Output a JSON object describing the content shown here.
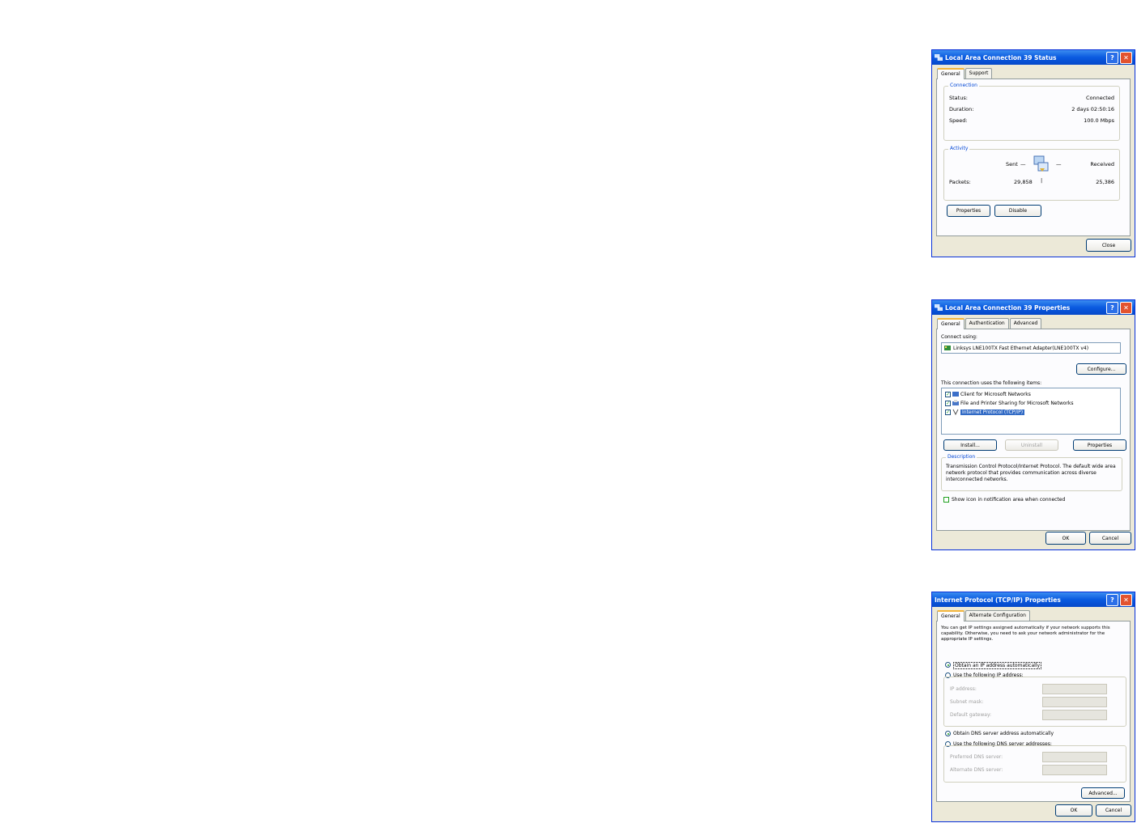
{
  "status_window": {
    "title": "Local Area Connection 39 Status",
    "tabs": [
      "General",
      "Support"
    ],
    "connection_group": "Connection",
    "status_label": "Status:",
    "status_value": "Connected",
    "duration_label": "Duration:",
    "duration_value": "2 days 02:50:16",
    "speed_label": "Speed:",
    "speed_value": "100.0 Mbps",
    "activity_group": "Activity",
    "sent_label": "Sent",
    "received_label": "Received",
    "packets_label": "Packets:",
    "packets_sent": "29,858",
    "packets_received": "25,386",
    "properties_button": "Properties",
    "disable_button": "Disable",
    "close_button": "Close"
  },
  "properties_window": {
    "title": "Local Area Connection 39 Properties",
    "tabs": [
      "General",
      "Authentication",
      "Advanced"
    ],
    "connect_using_label": "Connect using:",
    "adapter_name": "Linksys LNE100TX Fast Ethernet Adapter(LNE100TX v4)",
    "configure_button": "Configure...",
    "items_label": "This connection uses the following items:",
    "items": [
      {
        "label": "Client for Microsoft Networks",
        "checked": true
      },
      {
        "label": "File and Printer Sharing for Microsoft Networks",
        "checked": true
      },
      {
        "label": "Internet Protocol (TCP/IP)",
        "checked": true
      }
    ],
    "install_button": "Install...",
    "uninstall_button": "Uninstall",
    "properties_button": "Properties",
    "description_group": "Description",
    "description_text": "Transmission Control Protocol/Internet Protocol. The default wide area network protocol that provides communication across diverse interconnected networks.",
    "show_icon_label": "Show icon in notification area when connected",
    "ok_button": "OK",
    "cancel_button": "Cancel"
  },
  "tcpip_window": {
    "title": "Internet Protocol (TCP/IP) Properties",
    "tabs": [
      "General",
      "Alternate Configuration"
    ],
    "intro_text": "You can get IP settings assigned automatically if your network supports this capability. Otherwise, you need to ask your network administrator for the appropriate IP settings.",
    "obtain_ip_label": "Obtain an IP address automatically",
    "use_ip_label": "Use the following IP address:",
    "ip_address_label": "IP address:",
    "subnet_label": "Subnet mask:",
    "gateway_label": "Default gateway:",
    "obtain_dns_label": "Obtain DNS server address automatically",
    "use_dns_label": "Use the following DNS server addresses:",
    "preferred_dns_label": "Preferred DNS server:",
    "alternate_dns_label": "Alternate DNS server:",
    "advanced_button": "Advanced...",
    "ok_button": "OK",
    "cancel_button": "Cancel"
  },
  "title_buttons": {
    "help": "?",
    "close": "✕"
  },
  "colors": {
    "titlebar": "#0a5ae0",
    "dialog_bg": "#ece9d8",
    "group_label": "#0046d5",
    "close_red": "#e2532f"
  }
}
